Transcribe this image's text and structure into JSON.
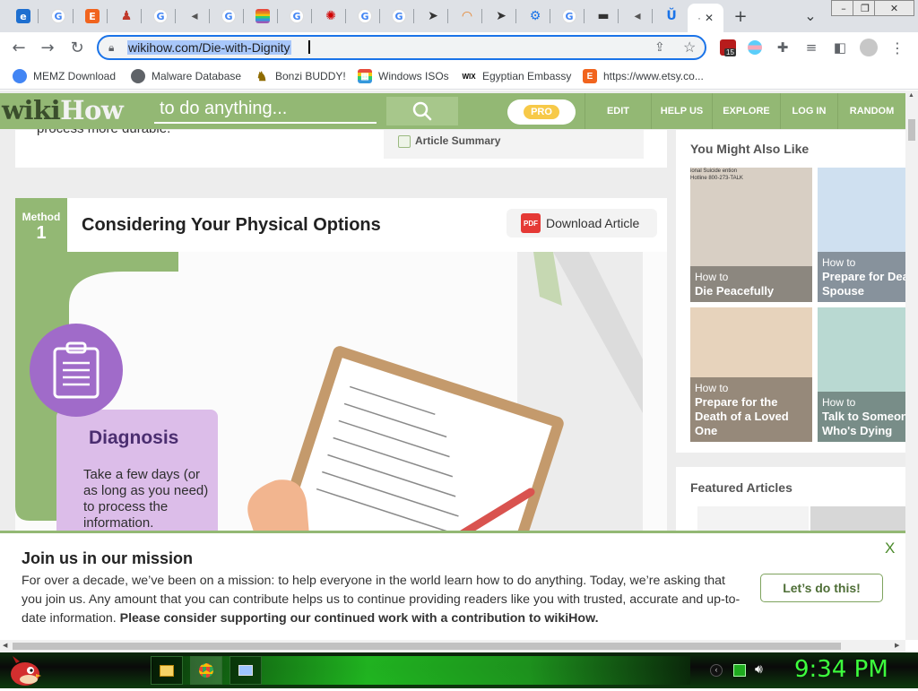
{
  "browser": {
    "url": "wikihow.com/Die-with-Dignity",
    "profile_badge": "15",
    "window_controls": {
      "minimize": "–",
      "restore": "❐",
      "close": "✕"
    },
    "tabs": [
      {
        "icon": "ie-icon",
        "letter": "e",
        "color": "#1e6fd0"
      },
      {
        "icon": "google-icon",
        "letter": "G",
        "color": "#ffffff"
      },
      {
        "icon": "etsy-icon",
        "letter": "E",
        "color": "#f1641e"
      },
      {
        "icon": "figure-icon",
        "letter": "♟",
        "color": "#c0392b"
      },
      {
        "icon": "google-icon",
        "letter": "G",
        "color": "#ffffff"
      },
      {
        "icon": "audio-icon",
        "letter": "◂",
        "color": "#555555"
      },
      {
        "icon": "google-icon",
        "letter": "G",
        "color": "#ffffff"
      },
      {
        "icon": "rainbow-icon",
        "letter": "",
        "color": "#e74c3c"
      },
      {
        "icon": "google-icon",
        "letter": "G",
        "color": "#ffffff"
      },
      {
        "icon": "cbc-icon",
        "letter": "✺",
        "color": "#d00000"
      },
      {
        "icon": "google-icon",
        "letter": "G",
        "color": "#ffffff"
      },
      {
        "icon": "google-icon",
        "letter": "G",
        "color": "#ffffff"
      },
      {
        "icon": "cursor-icon",
        "letter": "➤",
        "color": "#333333"
      },
      {
        "icon": "rainbow-icon",
        "letter": "◠",
        "color": "#e67e22"
      },
      {
        "icon": "cursor-icon",
        "letter": "➤",
        "color": "#333333"
      },
      {
        "icon": "gear-icon",
        "letter": "⚙",
        "color": "#1a73e8"
      },
      {
        "icon": "google-icon",
        "letter": "G",
        "color": "#ffffff"
      },
      {
        "icon": "car-icon",
        "letter": "▬",
        "color": "#333333"
      },
      {
        "icon": "audio-icon",
        "letter": "◂",
        "color": "#555555"
      },
      {
        "icon": "wikihow-tab-icon",
        "letter": "Ŭ",
        "color": "#1a73e8"
      }
    ],
    "active_tab_close": "✕",
    "new_tab": "+",
    "tab_menu": "⌄"
  },
  "bookmarks": [
    {
      "label": "MEMZ Download",
      "icon": "google-icon",
      "color": "#4285f4",
      "glyph": "G"
    },
    {
      "label": "Malware Database",
      "icon": "globe-icon",
      "color": "#5f6368",
      "glyph": "◉"
    },
    {
      "label": "Bonzi BUDDY!",
      "icon": "bonzi-icon",
      "color": "#8e6b00",
      "glyph": "♞"
    },
    {
      "label": "Windows ISOs",
      "icon": "windows-icon",
      "color": "#e74c3c",
      "glyph": "▦"
    },
    {
      "label": "Egyptian Embassy",
      "icon": "wix-icon",
      "color": "#000000",
      "glyph": "WIX"
    },
    {
      "label": "https://www.etsy.co...",
      "icon": "etsy-icon",
      "color": "#f1641e",
      "glyph": "E"
    }
  ],
  "wikihow": {
    "logo_wiki": "wiki",
    "logo_how": "How",
    "search_placeholder": "to do anything...",
    "pro": "PRO",
    "nav": [
      "EDIT",
      "HELP US",
      "EXPLORE",
      "LOG IN",
      "RANDOM"
    ],
    "partial_text": "process more durable.",
    "article_summary": "Article Summary",
    "method": {
      "label": "Method",
      "number": "1",
      "title": "Considering Your Physical Options",
      "download": "Download Article",
      "pdf": "PDF"
    },
    "diagnosis": {
      "title": "Diagnosis",
      "text": "Take a few days (or as long as you need) to process the information."
    },
    "sidebar": {
      "you_might_also_like": "You Might Also Like",
      "tiles": [
        {
          "how": "How to",
          "title": "Die Peacefully",
          "bg": "#d8cfc4"
        },
        {
          "how": "How to",
          "title": "Prepare for Dea... Spouse",
          "bg": "#cfe0f0"
        },
        {
          "how": "How to",
          "title": "Prepare for the Death of a Loved One",
          "bg": "#e7d3bc"
        },
        {
          "how": "How to",
          "title": "Talk to Someon... Who's Dying",
          "bg": "#b9d9d2"
        }
      ],
      "featured_articles": "Featured Articles",
      "tile_overlay_text": "ional Suicide ention Hotline 800-273-TALK"
    }
  },
  "banner": {
    "title": "Join us in our mission",
    "body": "For over a decade, we’ve been on a mission: to help everyone in the world learn how to do anything. Today, we’re asking that you join us. Any amount that you can contribute helps us to continue providing readers like you with trusted, accurate and up-to-date information. ",
    "body_bold": "Please consider supporting our continued work with a contribution to wikiHow.",
    "cta": "Let’s do this!",
    "close": "X"
  },
  "taskbar": {
    "clock": "9:34 PM"
  }
}
